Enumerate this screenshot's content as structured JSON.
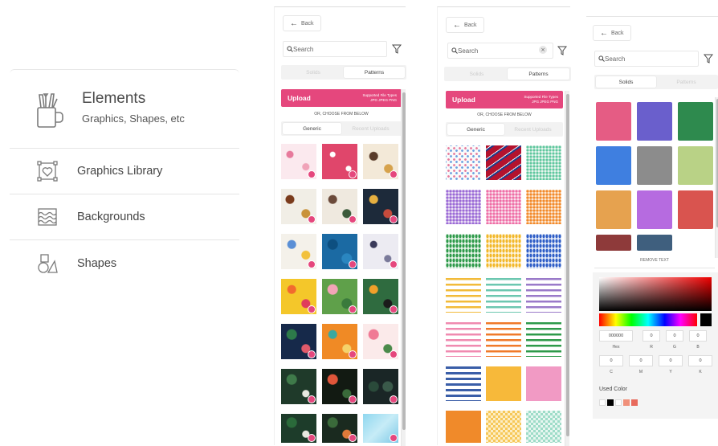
{
  "menu": {
    "header_title": "Elements",
    "header_subtitle": "Graphics, Shapes, etc",
    "items": [
      {
        "label": "Graphics Library",
        "icon": "graphics-library-icon"
      },
      {
        "label": "Backgrounds",
        "icon": "backgrounds-icon"
      },
      {
        "label": "Shapes",
        "icon": "shapes-icon"
      }
    ]
  },
  "panel_patterns_images": {
    "back_label": "Back",
    "search_placeholder": "Search",
    "tabs": [
      "Solids",
      "Patterns"
    ],
    "active_tab": "Patterns",
    "upload_label": "Upload",
    "upload_types_title": "Supported File Types",
    "upload_types": "JPG  JPEG  PNG",
    "or_text": "OR, CHOOSE FROM BELOW",
    "sub_tabs": [
      "Generic",
      "Recent Uploads"
    ],
    "active_sub_tab": "Generic"
  },
  "panel_patterns_generic": {
    "back_label": "Back",
    "search_placeholder": "Search",
    "tabs": [
      "Solids",
      "Patterns"
    ],
    "active_tab": "Patterns",
    "upload_label": "Upload",
    "upload_types_title": "Supported File Types",
    "upload_types": "JPG  JPEG  PNG",
    "or_text": "OR, CHOOSE FROM BELOW",
    "sub_tabs": [
      "Generic",
      "Recent Uploads"
    ],
    "active_sub_tab": "Generic"
  },
  "panel_solids": {
    "back_label": "Back",
    "search_placeholder": "Search",
    "tabs": [
      "Solids",
      "Patterns"
    ],
    "active_tab": "Solids",
    "swatches": [
      "#e55c84",
      "#6a5fcc",
      "#2e8a4e",
      "#3f7fe0",
      "#8c8c8c",
      "#b9d286",
      "#e6a24f",
      "#b66be0",
      "#d9544f",
      "#8e3a3a",
      "#3f5f7e"
    ],
    "remove_text": "REMOVE TEXT",
    "hex_value": "000000",
    "rgb_values": [
      "0",
      "0",
      "0"
    ],
    "hex_label": "Hex",
    "rgb_labels": [
      "R",
      "G",
      "B"
    ],
    "cmyk_values": [
      "0",
      "0",
      "0",
      "0"
    ],
    "cmyk_labels": [
      "C",
      "M",
      "Y",
      "K"
    ],
    "used_color_label": "Used Color",
    "used_colors": [
      "#ffffff",
      "#000000",
      "#ffffff",
      "#f0907a",
      "#e86a5c"
    ]
  },
  "colors": {
    "accent": "#e5477d"
  }
}
